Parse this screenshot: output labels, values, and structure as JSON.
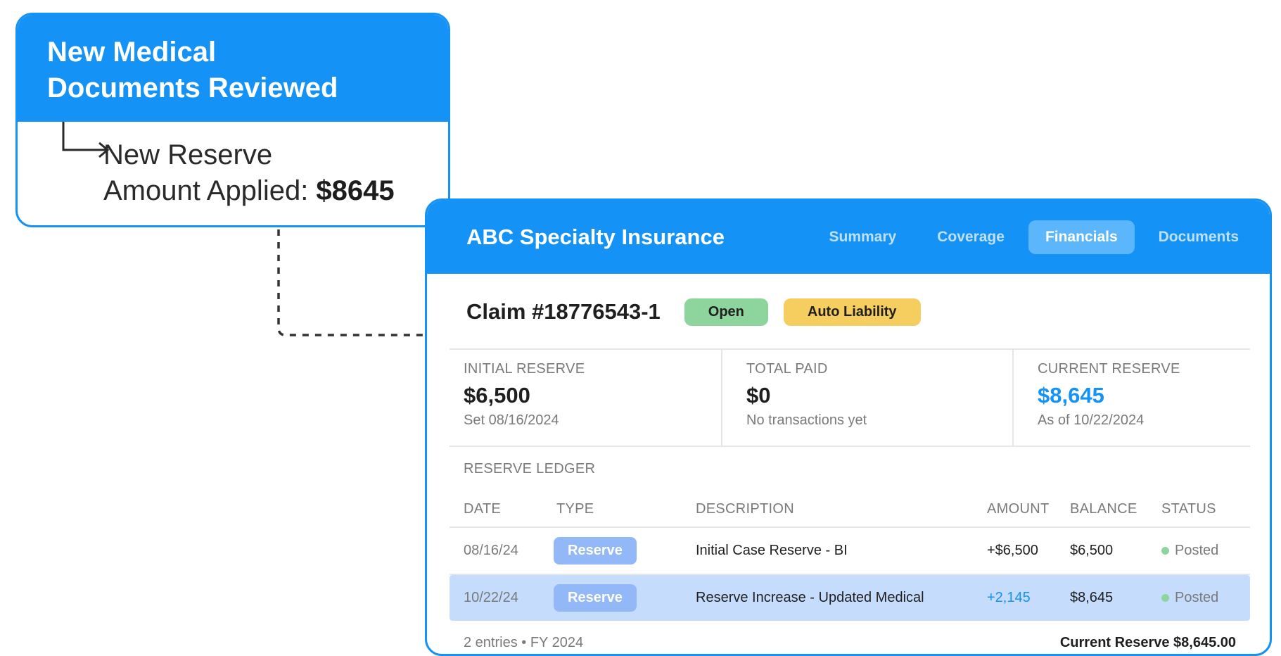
{
  "notification": {
    "title_line1": "New Medical",
    "title_line2": "Documents Reviewed",
    "body_line1": "New Reserve",
    "body_line2_prefix": "Amount Applied: ",
    "body_amount": "$8645"
  },
  "panel": {
    "brand": "ABC Specialty Insurance",
    "tabs": [
      {
        "label": "Summary",
        "active": false
      },
      {
        "label": "Coverage",
        "active": false
      },
      {
        "label": "Financials",
        "active": true
      },
      {
        "label": "Documents",
        "active": false
      }
    ],
    "claim": {
      "title": "Claim #18776543-1",
      "status_badge": "Open",
      "type_badge": "Auto Liability"
    },
    "metrics": [
      {
        "label": "INITIAL RESERVE",
        "value": "$6,500",
        "sub": "Set 08/16/2024"
      },
      {
        "label": "TOTAL PAID",
        "value": "$0",
        "sub": "No transactions yet"
      },
      {
        "label": "CURRENT RESERVE",
        "value": "$8,645",
        "sub": "As of 10/22/2024"
      }
    ],
    "ledger": {
      "title": "RESERVE LEDGER",
      "columns": [
        "DATE",
        "TYPE",
        "DESCRIPTION",
        "AMOUNT",
        "BALANCE",
        "STATUS"
      ],
      "rows": [
        {
          "date": "08/16/24",
          "type": "Reserve",
          "description": "Initial Case Reserve - BI",
          "amount": "+$6,500",
          "balance": "$6,500",
          "status": "Posted"
        },
        {
          "date": "10/22/24",
          "type": "Reserve",
          "description": "Reserve Increase - Updated Medical",
          "amount": "+2,145",
          "balance": "$8,645",
          "status": "Posted"
        }
      ]
    },
    "footer": {
      "left": "2 entries • FY 2024",
      "right": "Current Reserve $8,645.00"
    }
  },
  "colors": {
    "primary": "#1592f6",
    "highlight_row": "#c6dcfc",
    "badge_open": "#8ed49d",
    "badge_auto": "#f6cd5f",
    "pill_reserve": "#93b8f8"
  }
}
